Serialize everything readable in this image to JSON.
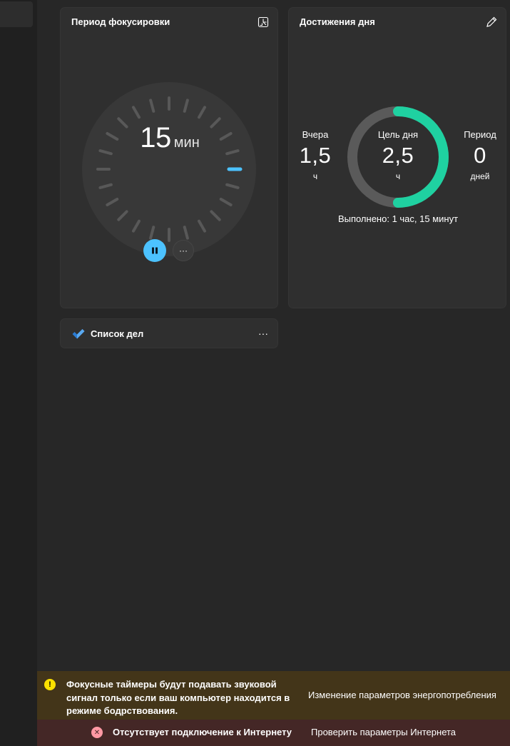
{
  "focus_session": {
    "title": "Период фокусировки",
    "timer_value": "15",
    "timer_unit": "мин",
    "timer_minutes": 15,
    "more_label": "···"
  },
  "daily_progress": {
    "title": "Достижения дня",
    "yesterday": {
      "label": "Вчера",
      "value": "1,5",
      "unit": "ч"
    },
    "daily_goal": {
      "label": "Цель дня",
      "value": "2,5",
      "unit": "ч"
    },
    "streak": {
      "label": "Период",
      "value": "0",
      "unit": "дней"
    },
    "completed_text": "Выполнено: 1 час, 15 минут",
    "progress_fraction": 0.5
  },
  "todo": {
    "title": "Список дел",
    "more_label": "···"
  },
  "banners": {
    "warning_text": "Фокусные таймеры будут подавать звуковой сигнал только если ваш компьютер находится в режиме бодрствования.",
    "warning_link": "Изменение параметров энергопотребления",
    "error_text": "Отсутствует подключение к Интернету",
    "error_link": "Проверить параметры Интернета"
  },
  "colors": {
    "accent": "#4cc2ff",
    "ring_progress": "#1fd1a1",
    "ring_track": "#5a5a5a",
    "warning_bg": "#433519",
    "error_bg": "#442726"
  }
}
